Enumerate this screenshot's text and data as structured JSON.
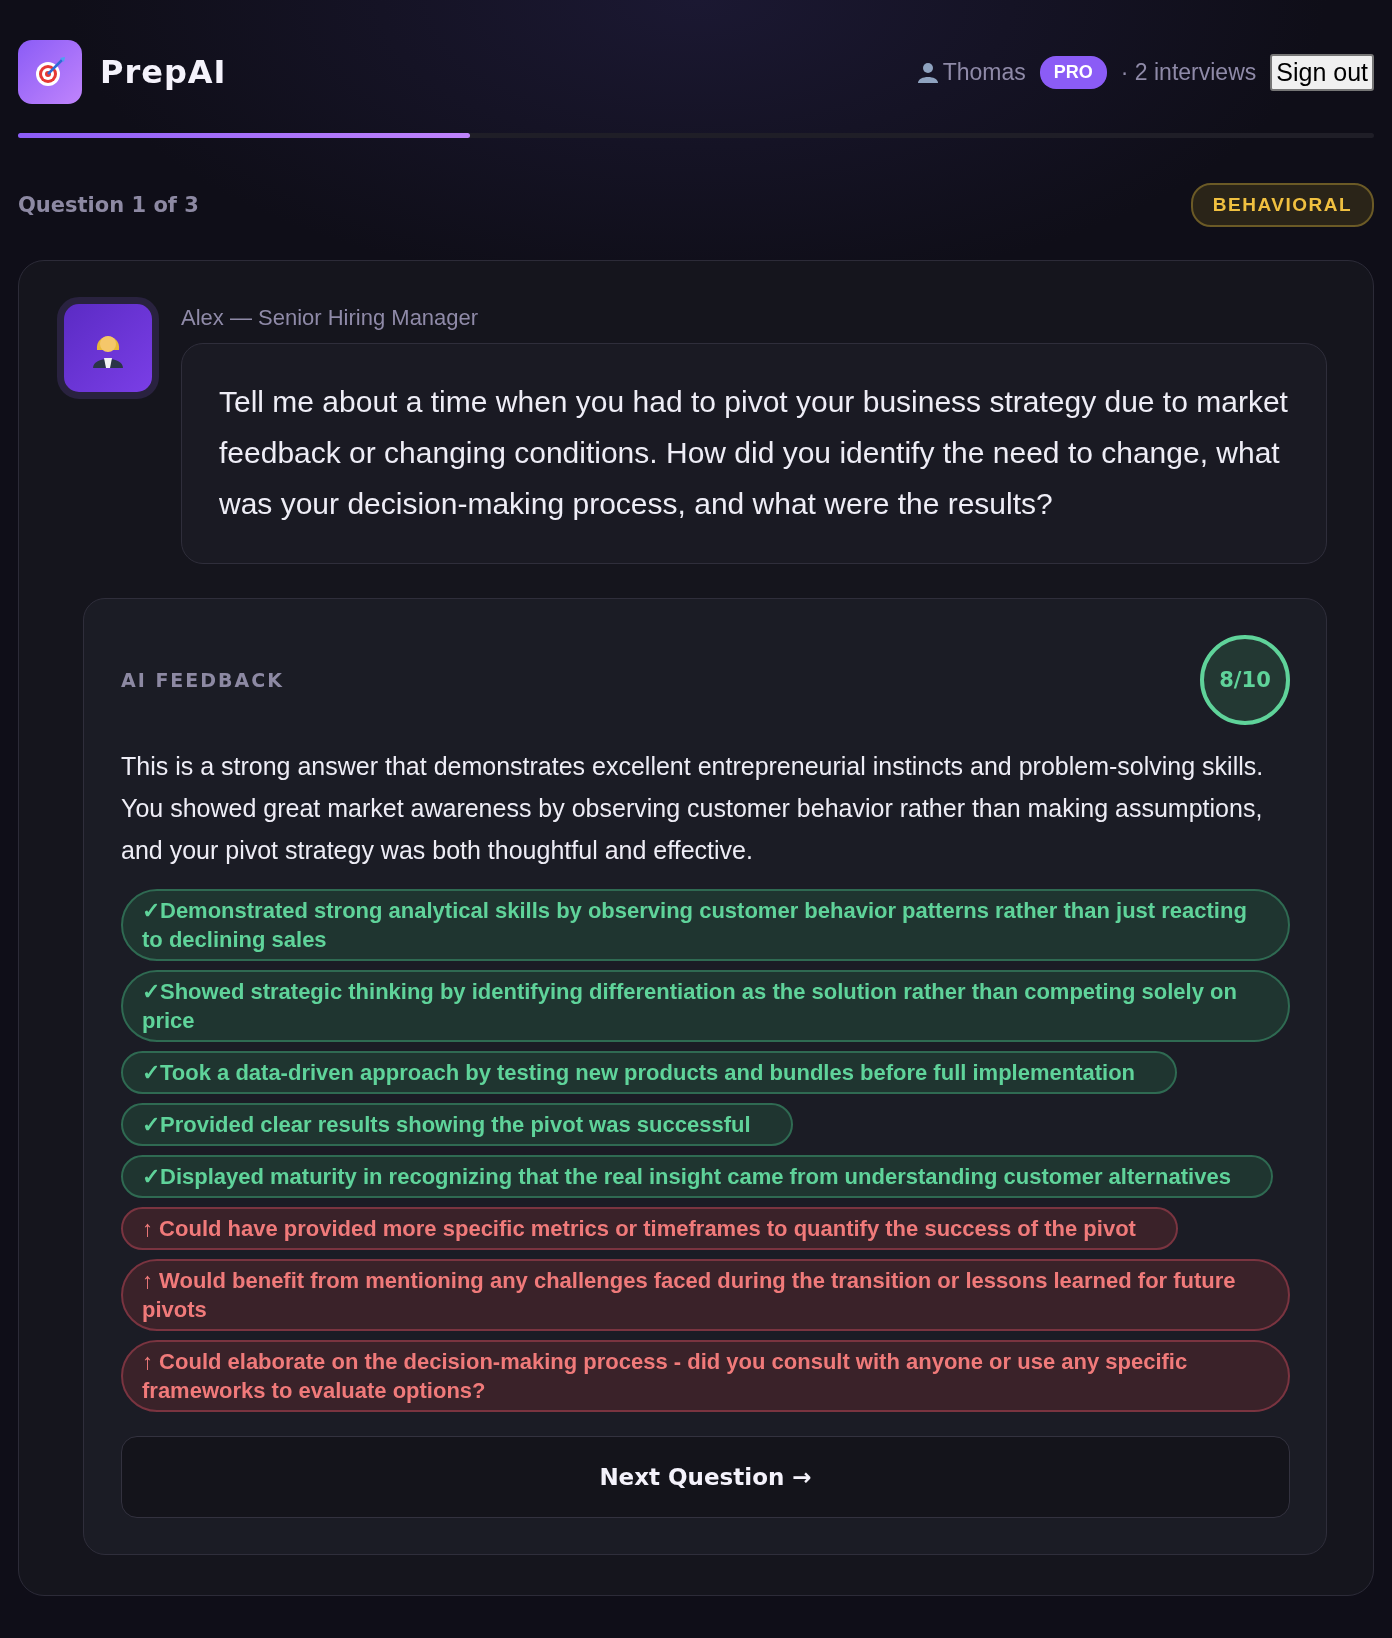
{
  "header": {
    "brand": "PrepAI",
    "user": "Thomas",
    "plan": "PRO",
    "interviews": "· 2 interviews",
    "sign_out": "Sign out",
    "progress": {
      "level": 0.333
    }
  },
  "question_label": "Question 1 of 3",
  "category": "BEHAVIORAL",
  "interviewer": {
    "name": "Alex — Senior Hiring Manager"
  },
  "question": "Tell me about a time when you had to pivot your business strategy due to market feedback or changing conditions. How did you identify the need to change, what was your decision-making process, and what were the results?",
  "feedback": {
    "title": "AI FEEDBACK",
    "score": "8/10",
    "summary": "This is a strong answer that demonstrates excellent entrepreneurial instincts and problem-solving skills. You showed great market awareness by observing customer behavior rather than making assumptions, and your pivot strategy was both thoughtful and effective.",
    "points": [
      {
        "kind": "strength",
        "text": "✓Demonstrated strong analytical skills by observing customer behavior patterns rather than just reacting to declining sales"
      },
      {
        "kind": "strength",
        "text": "✓Showed strategic thinking by identifying differentiation as the solution rather than competing solely on price"
      },
      {
        "kind": "strength",
        "text": "✓Took a data-driven approach by testing new products and bundles before full implementation"
      },
      {
        "kind": "strength",
        "text": "✓Provided clear results showing the pivot was successful"
      },
      {
        "kind": "strength",
        "text": "✓Displayed maturity in recognizing that the real insight came from understanding customer alternatives"
      },
      {
        "kind": "improvement",
        "text": "↑ Could have provided more specific metrics or timeframes to quantify the success of the pivot"
      },
      {
        "kind": "improvement",
        "text": "↑ Would benefit from mentioning any challenges faced during the transition or lessons learned for future pivots"
      },
      {
        "kind": "improvement",
        "text": "↑ Could elaborate on the decision-making process - did you consult with anyone or use any specific frameworks to evaluate options?"
      }
    ],
    "next": "Next Question →"
  }
}
